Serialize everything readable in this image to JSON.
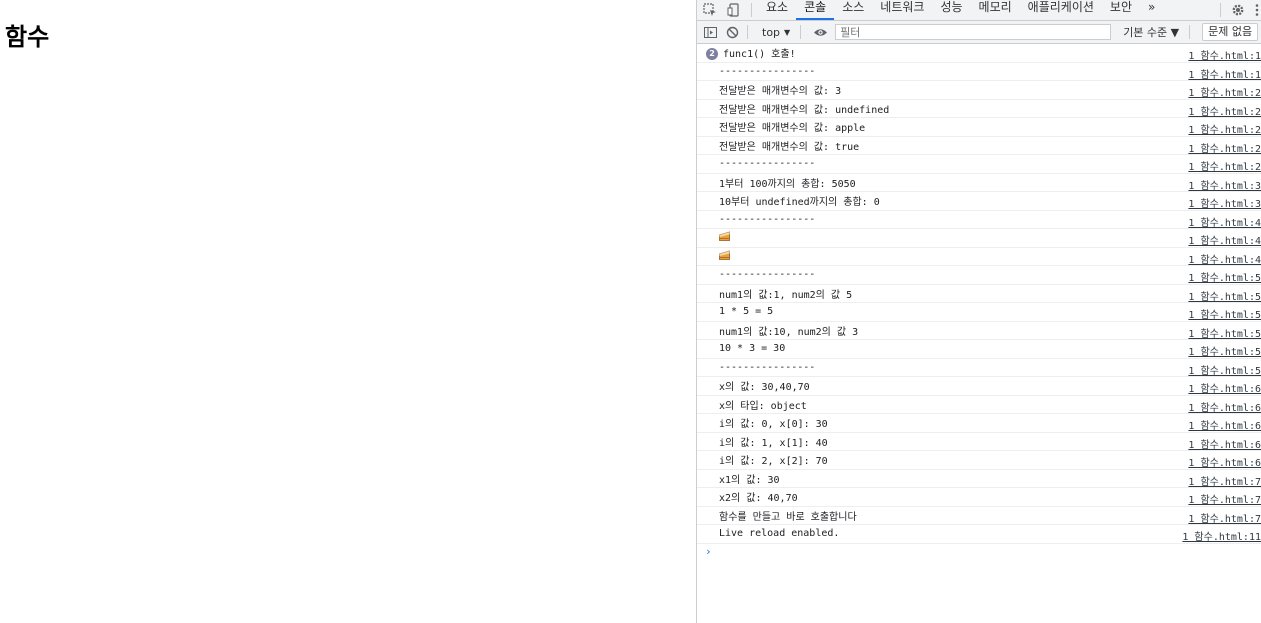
{
  "page": {
    "heading": "함수"
  },
  "devtools": {
    "tabs": [
      "요소",
      "콘솔",
      "소스",
      "네트워크",
      "성능",
      "메모리",
      "애플리케이션",
      "보안"
    ],
    "active_tab": "콘솔",
    "more_label": "»",
    "toolbar": {
      "context": "top",
      "filter_placeholder": "필터",
      "levels": "기본 수준 ▼",
      "issues": "문제 없음"
    },
    "console": {
      "repeat_count": "2",
      "rows": [
        {
          "msg": "func1() 호출!",
          "src": "1 함수.html:1"
        },
        {
          "msg": "----------------",
          "src": "1 함수.html:1"
        },
        {
          "msg": "전달받은 매개변수의 값: 3",
          "src": "1 함수.html:2"
        },
        {
          "msg": "전달받은 매개변수의 값: undefined",
          "src": "1 함수.html:2"
        },
        {
          "msg": "전달받은 매개변수의 값: apple",
          "src": "1 함수.html:2"
        },
        {
          "msg": "전달받은 매개변수의 값: true",
          "src": "1 함수.html:2"
        },
        {
          "msg": "----------------",
          "src": "1 함수.html:2"
        },
        {
          "msg": "1부터 100까지의 총합: 5050",
          "src": "1 함수.html:3"
        },
        {
          "msg": "10부터 undefined까지의 총합: 0",
          "src": "1 함수.html:3"
        },
        {
          "msg": "----------------",
          "src": "1 함수.html:4"
        },
        {
          "msg": "",
          "src": "1 함수.html:4",
          "icon": "cake-icon"
        },
        {
          "msg": "",
          "src": "1 함수.html:4",
          "icon": "cake-icon"
        },
        {
          "msg": "----------------",
          "src": "1 함수.html:5"
        },
        {
          "msg": "num1의 값:1, num2의 값 5",
          "src": "1 함수.html:5"
        },
        {
          "msg": "1 * 5 = 5",
          "src": "1 함수.html:5"
        },
        {
          "msg": "num1의 값:10, num2의 값 3",
          "src": "1 함수.html:5"
        },
        {
          "msg": "10 * 3 = 30",
          "src": "1 함수.html:5"
        },
        {
          "msg": "----------------",
          "src": "1 함수.html:5"
        },
        {
          "msg": "x의 값: 30,40,70",
          "src": "1 함수.html:6"
        },
        {
          "msg": "x의 타입: object",
          "src": "1 함수.html:6"
        },
        {
          "msg": "i의 값: 0, x[0]: 30",
          "src": "1 함수.html:6"
        },
        {
          "msg": "i의 값: 1, x[1]: 40",
          "src": "1 함수.html:6"
        },
        {
          "msg": "i의 값: 2, x[2]: 70",
          "src": "1 함수.html:6"
        },
        {
          "msg": "x1의 값: 30",
          "src": "1 함수.html:7"
        },
        {
          "msg": "x2의 값: 40,70",
          "src": "1 함수.html:7"
        },
        {
          "msg": "함수를 만들고 바로 호출합니다",
          "src": "1 함수.html:7"
        },
        {
          "msg": "Live reload enabled.",
          "src": "1 함수.html:11"
        }
      ],
      "prompt": "›"
    },
    "colors": {
      "accent": "#1a73e8",
      "badge": "#7f7f9f"
    }
  }
}
